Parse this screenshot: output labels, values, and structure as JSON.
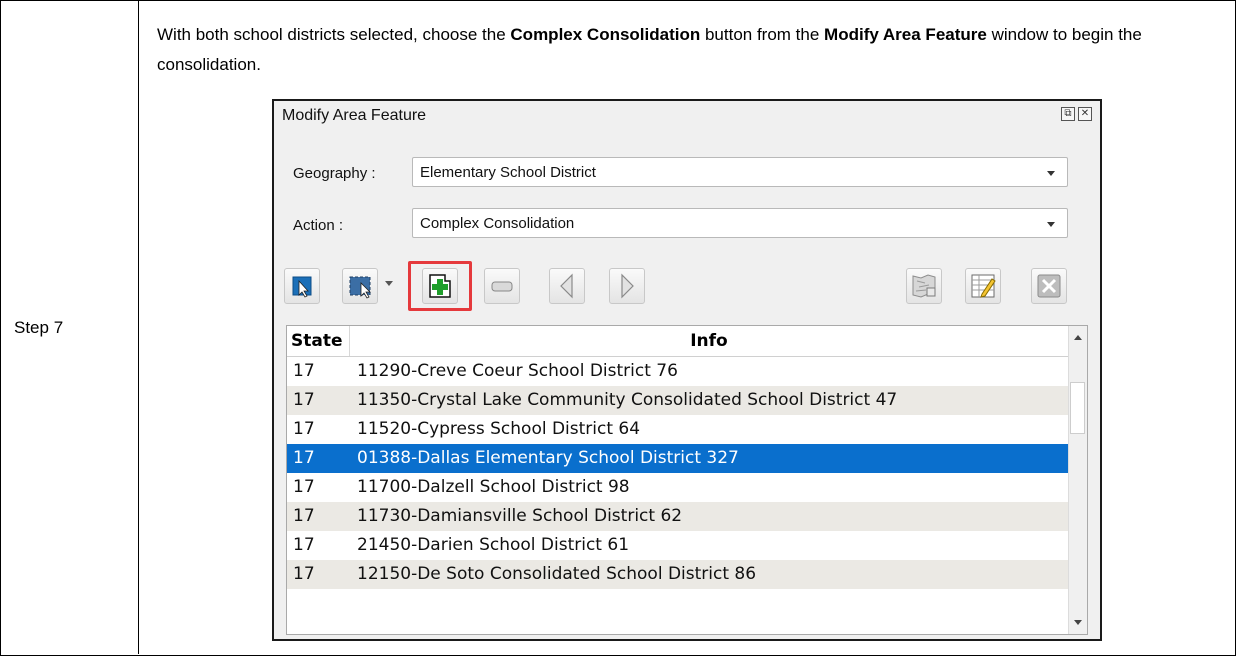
{
  "step": {
    "label": "Step 7",
    "instruction": {
      "t1": "With both school districts selected, choose the ",
      "b1": "Complex Consolidation",
      "t2": " button from the ",
      "b2": "Modify Area Feature",
      "t3": " window to begin the consolidation."
    }
  },
  "window": {
    "title": "Modify Area Feature",
    "restore_glyph": "⧉",
    "close_glyph": "✕",
    "geography": {
      "label": "Geography :",
      "value": "Elementary School District"
    },
    "action": {
      "label": "Action :",
      "value": "Complex Consolidation"
    },
    "toolbar": {
      "icons": [
        "select-feature-icon",
        "rectangle-select-icon",
        "complex-consolidation-icon",
        "remove-icon",
        "previous-icon",
        "next-icon",
        "map-edit-icon",
        "table-edit-icon",
        "delete-icon"
      ],
      "highlight_color": "#e5393c"
    },
    "grid": {
      "headers": {
        "state": "State",
        "info": "Info"
      },
      "rows": [
        {
          "state": "17",
          "info": "11290-Creve Coeur School District 76",
          "selected": false
        },
        {
          "state": "17",
          "info": "11350-Crystal Lake Community Consolidated School District 47",
          "selected": false
        },
        {
          "state": "17",
          "info": "11520-Cypress School District 64",
          "selected": false
        },
        {
          "state": "17",
          "info": "01388-Dallas Elementary School District 327",
          "selected": true
        },
        {
          "state": "17",
          "info": "11700-Dalzell School District 98",
          "selected": false
        },
        {
          "state": "17",
          "info": "11730-Damiansville School District 62",
          "selected": false
        },
        {
          "state": "17",
          "info": "21450-Darien School District 61",
          "selected": false
        },
        {
          "state": "17",
          "info": "12150-De Soto Consolidated School District 86",
          "selected": false
        }
      ],
      "selected_color": "#0a6fcd"
    }
  }
}
